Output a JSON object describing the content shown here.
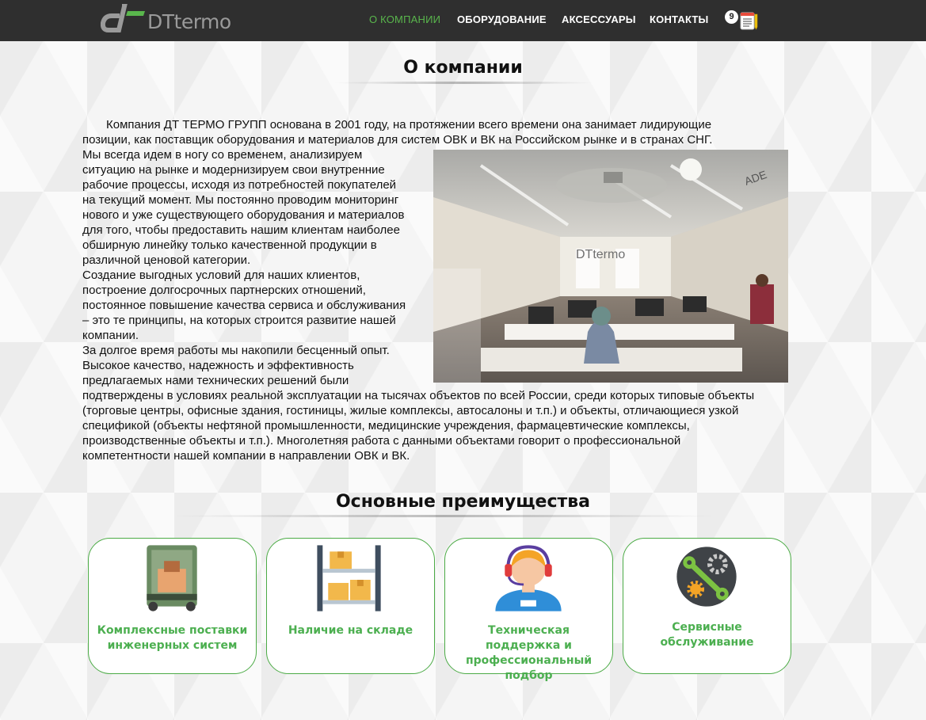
{
  "header": {
    "logo_text": "DTtermo",
    "nav": [
      {
        "label": "О КОМПАНИИ",
        "active": true
      },
      {
        "label": "ОБОРУДОВАНИЕ",
        "active": false
      },
      {
        "label": "АКСЕССУАРЫ",
        "active": false
      },
      {
        "label": "КОНТАКТЫ",
        "active": false
      }
    ],
    "cart_count": "9"
  },
  "about": {
    "title": "О компании",
    "paragraph_lines": [
      "Компания ДТ ТЕРМО ГРУПП основана в 2001 году, на протяжении всего времени она занимает лидирующие",
      "позиции, как поставщик оборудования и материалов для систем ОВК и ВК на Российском рынке и в странах СНГ.",
      "Мы всегда идем в ногу со временем, анализируем",
      "ситуацию на рынке и модернизируем свои внутренние",
      "рабочие процессы, исходя из потребностей покупателей",
      "на текущий момент. Мы постоянно проводим мониторинг",
      "нового и уже существующего оборудования и материалов",
      "для того, чтобы предоставить нашим клиентам наиболее",
      "обширную линейку только качественной продукции в",
      "различной ценовой категории.",
      "Создание выгодных условий для наших клиентов,",
      "построение долгосрочных партнерских отношений,",
      "постоянное повышение качества сервиса и обслуживания",
      "– это те принципы, на которых строится развитие нашей",
      "компании.",
      "За долгое время работы мы накопили бесценный опыт.",
      "Высокое качество, надежность и эффективность",
      "предлагаемых нами технических решений были",
      "подтверждены в условиях реальной эксплуатации на тысячах объектов по всей России, среди которых типовые объекты",
      "(торговые центры, офисные здания, гостиницы, жилые комплексы, автосалоны и т.п.) и объекты, отличающиеся узкой",
      "спецификой (объекты нефтяной промышленности, медицинские учреждения, фармацевтические комплексы,",
      "производственные объекты и т.п.). Многолетняя работа с данными объектами говорит о профессиональной",
      "компетентности нашей компании в направлении ОВК и ВК."
    ],
    "photo_sign": "DTtermo",
    "photo_wall_text": "ADE"
  },
  "advantages": {
    "title": "Основные преимущества",
    "items": [
      {
        "label": "Комплексные поставки инженерных систем",
        "icon": "truck-icon"
      },
      {
        "label": "Наличие на складе",
        "icon": "warehouse-shelf-icon"
      },
      {
        "label": "Техническая поддержка и профессиональный подбор",
        "icon": "support-operator-icon"
      },
      {
        "label": "Сервисные обслуживание",
        "icon": "service-gears-icon"
      }
    ]
  },
  "colors": {
    "navbar": "#2f2f2f",
    "accent_green": "#4caf50",
    "nav_active": "#59b64c"
  }
}
